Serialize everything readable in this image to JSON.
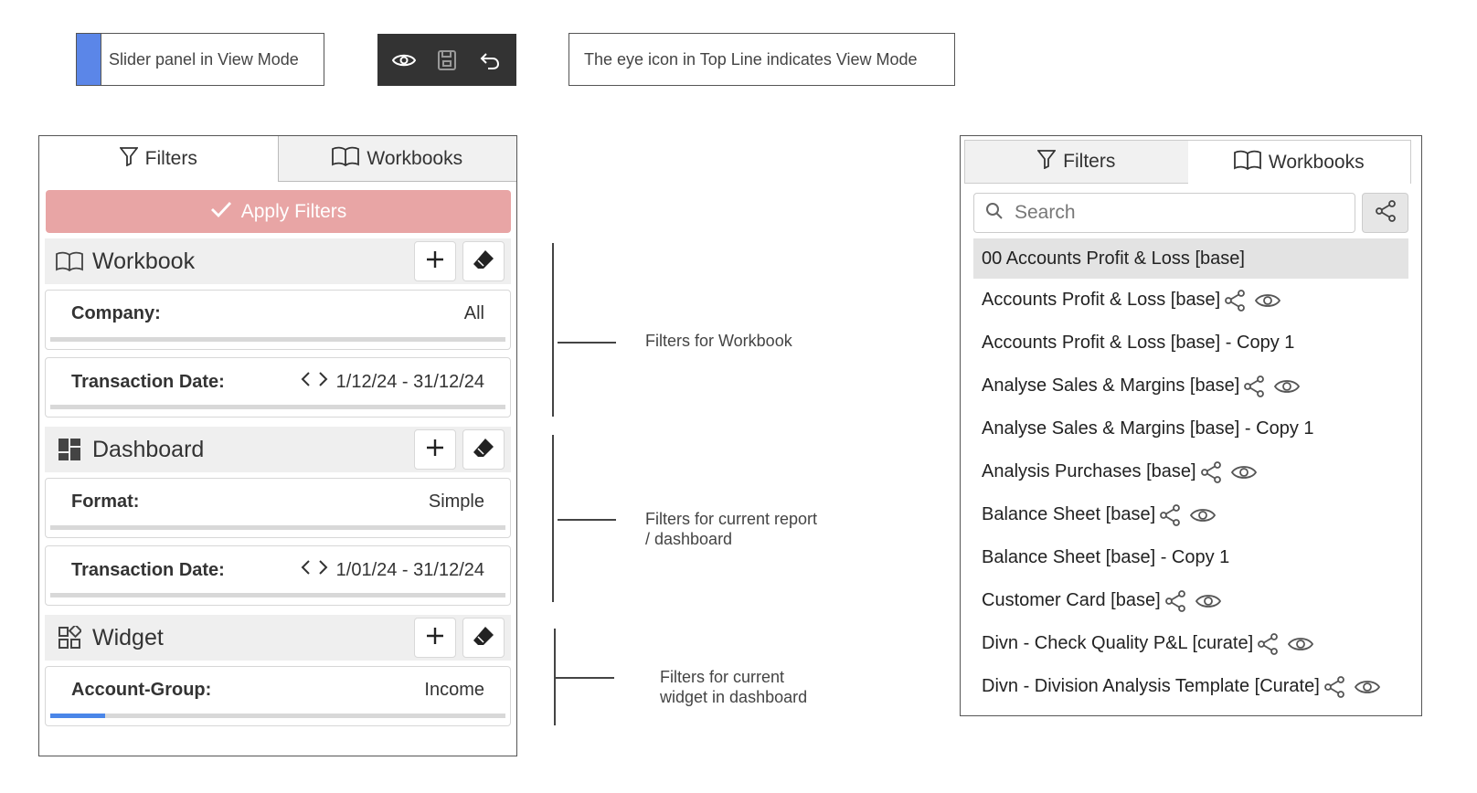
{
  "legend": {
    "slider_text": "Slider panel in View Mode",
    "swatch_color": "#5b86e8"
  },
  "topline": {
    "icons": [
      "eye-icon",
      "save-icon",
      "undo-icon"
    ]
  },
  "note": {
    "text": "The eye icon in Top Line indicates View Mode"
  },
  "left_panel": {
    "tabs": {
      "filters": "Filters",
      "workbooks": "Workbooks"
    },
    "apply_label": "Apply Filters",
    "sections": {
      "workbook": {
        "title": "Workbook",
        "filters": [
          {
            "label": "Company:",
            "value": "All"
          },
          {
            "label": "Transaction Date:",
            "value": "1/12/24 - 31/12/24"
          }
        ]
      },
      "dashboard": {
        "title": "Dashboard",
        "filters": [
          {
            "label": "Format:",
            "value": "Simple"
          },
          {
            "label": "Transaction Date:",
            "value": "1/01/24 - 31/12/24"
          }
        ]
      },
      "widget": {
        "title": "Widget",
        "filters": [
          {
            "label": "Account-Group:",
            "value": "Income",
            "slider_level": 0.12
          }
        ]
      }
    }
  },
  "annotations": {
    "workbook": "Filters for Workbook",
    "dashboard_line1": "Filters for current report",
    "dashboard_line2": "/ dashboard",
    "widget_line1": "Filters for current",
    "widget_line2": "widget in dashboard"
  },
  "right_panel": {
    "tabs": {
      "filters": "Filters",
      "workbooks": "Workbooks"
    },
    "search_placeholder": "Search",
    "workbooks": [
      {
        "name": "00 Accounts Profit & Loss [base]",
        "share": false,
        "view": false,
        "selected": true
      },
      {
        "name": "Accounts Profit & Loss [base]",
        "share": true,
        "view": true
      },
      {
        "name": "Accounts Profit & Loss [base] - Copy 1",
        "share": false,
        "view": false
      },
      {
        "name": "Analyse Sales & Margins [base]",
        "share": true,
        "view": true
      },
      {
        "name": "Analyse Sales & Margins [base] - Copy 1",
        "share": false,
        "view": false
      },
      {
        "name": "Analysis Purchases [base]",
        "share": true,
        "view": true
      },
      {
        "name": "Balance Sheet [base]",
        "share": true,
        "view": true
      },
      {
        "name": "Balance Sheet [base] - Copy 1",
        "share": false,
        "view": false
      },
      {
        "name": "Customer Card [base]",
        "share": true,
        "view": true
      },
      {
        "name": "Divn - Check Quality P&L [curate]",
        "share": true,
        "view": true
      },
      {
        "name": "Divn - Division Analysis Template [Curate]",
        "share": true,
        "view": true
      }
    ]
  }
}
